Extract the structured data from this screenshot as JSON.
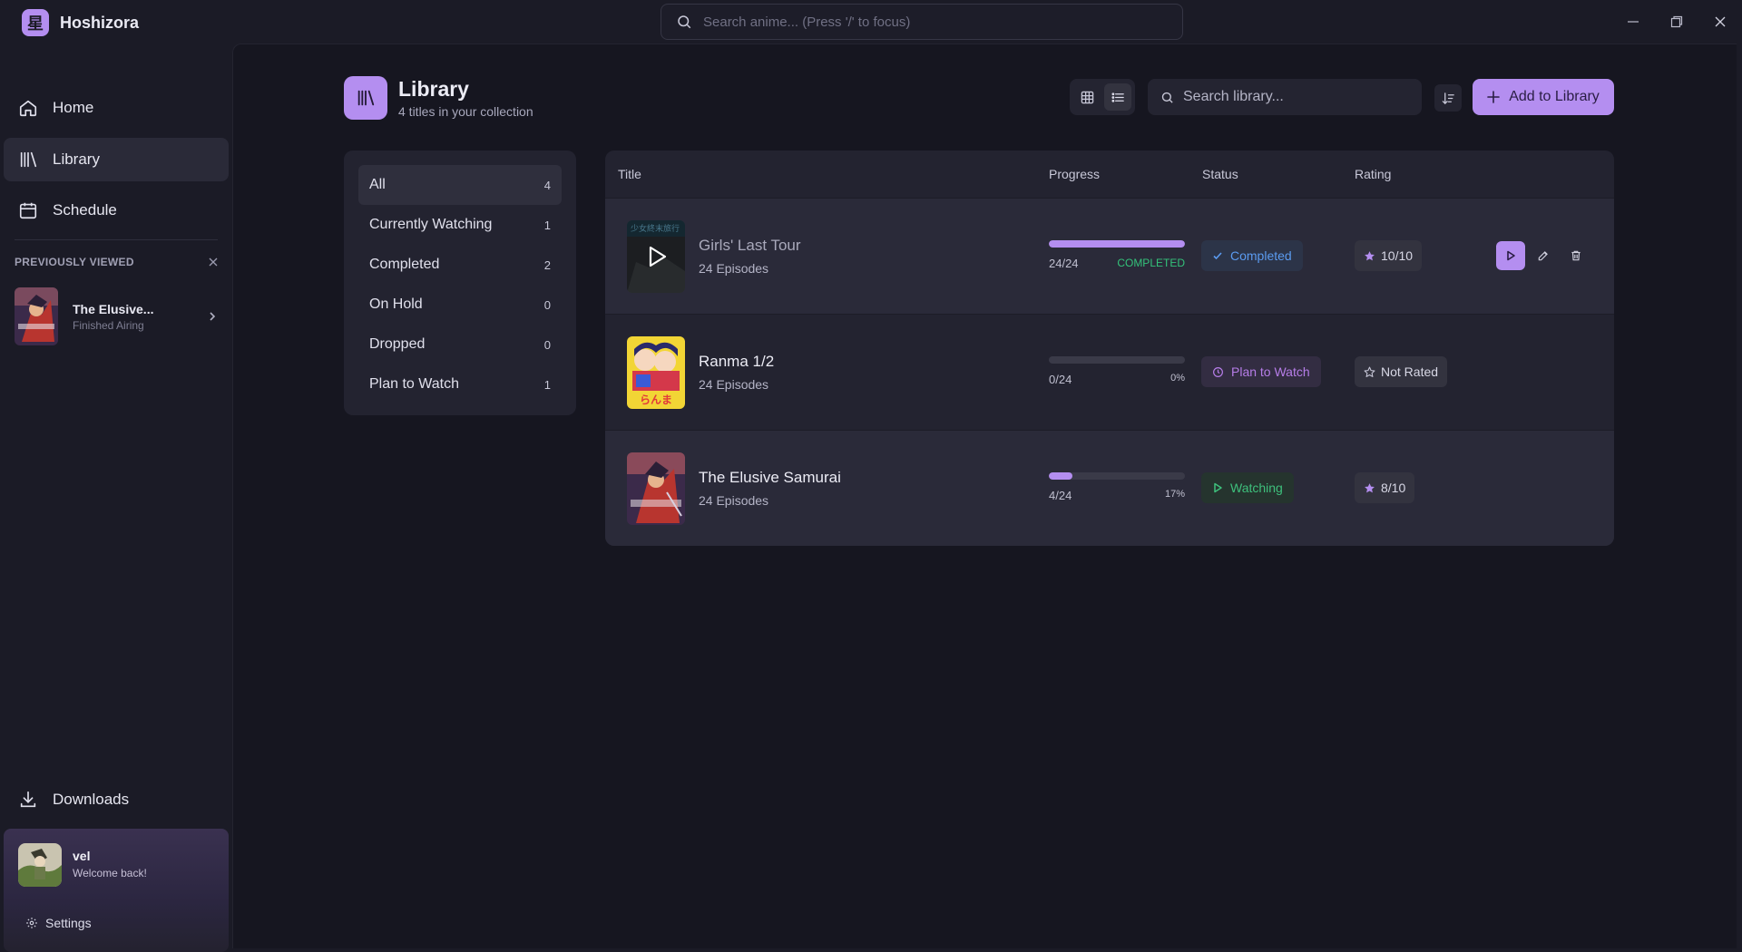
{
  "app": {
    "name": "Hoshizora",
    "logo_glyph": "星",
    "search_placeholder": "Search anime... (Press '/' to focus)"
  },
  "colors": {
    "accent": "#b48ef0",
    "background": "#1b1b26",
    "panel": "#232330",
    "completed": "#5b9bf0",
    "plan": "#b67de8",
    "watching": "#3ec07c"
  },
  "sidebar": {
    "nav": [
      {
        "label": "Home",
        "icon": "home-icon"
      },
      {
        "label": "Library",
        "icon": "library-icon",
        "active": true
      },
      {
        "label": "Schedule",
        "icon": "calendar-icon"
      }
    ],
    "previously_viewed": {
      "header": "PREVIOUSLY VIEWED",
      "items": [
        {
          "title": "The Elusive...",
          "subtitle": "Finished Airing"
        }
      ]
    },
    "downloads_label": "Downloads",
    "user": {
      "name": "vel",
      "greeting": "Welcome back!"
    },
    "settings_label": "Settings"
  },
  "library": {
    "title": "Library",
    "subtitle": "4 titles in your collection",
    "search_placeholder": "Search library...",
    "add_label": "Add to Library",
    "view_mode": "list"
  },
  "filters": [
    {
      "label": "All",
      "count": "4",
      "active": true
    },
    {
      "label": "Currently Watching",
      "count": "1"
    },
    {
      "label": "Completed",
      "count": "2"
    },
    {
      "label": "On Hold",
      "count": "0"
    },
    {
      "label": "Dropped",
      "count": "0"
    },
    {
      "label": "Plan to Watch",
      "count": "1"
    }
  ],
  "table": {
    "columns": {
      "title": "Title",
      "progress": "Progress",
      "status": "Status",
      "rating": "Rating"
    },
    "rows": [
      {
        "title": "Girls' Last Tour",
        "episodes": "24 Episodes",
        "progress_text": "24/24",
        "progress_fraction": 1.0,
        "progress_right": "COMPLETED",
        "status": "Completed",
        "status_icon": "check-icon",
        "rating": "10/10",
        "rating_icon": "star-filled-icon"
      },
      {
        "title": "Ranma 1/2",
        "episodes": "24 Episodes",
        "progress_text": "0/24",
        "progress_fraction": 0.0,
        "progress_right": "0%",
        "status": "Plan to Watch",
        "status_icon": "clock-icon",
        "rating": "Not Rated",
        "rating_icon": "star-outline-icon"
      },
      {
        "title": "The Elusive Samurai",
        "episodes": "24 Episodes",
        "progress_text": "4/24",
        "progress_fraction": 0.17,
        "progress_right": "17%",
        "status": "Watching",
        "status_icon": "play-icon",
        "rating": "8/10",
        "rating_icon": "star-filled-icon"
      }
    ]
  }
}
